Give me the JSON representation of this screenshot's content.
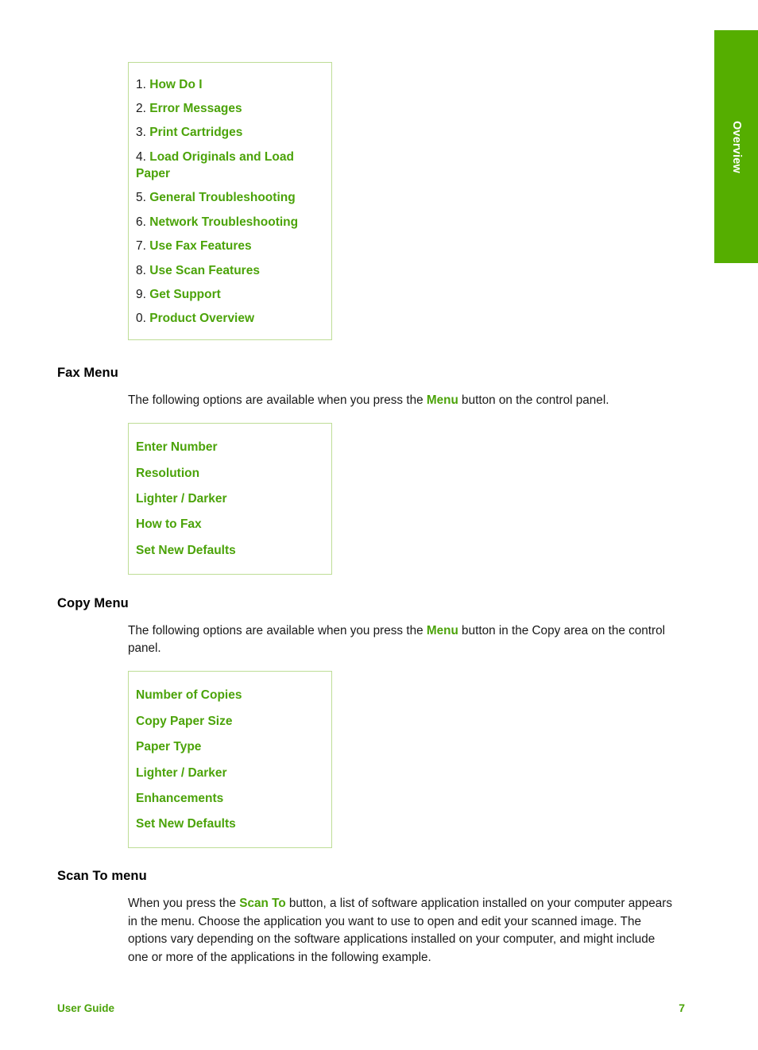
{
  "colors": {
    "accent_green": "#4ba309",
    "tab_green": "#55ae00",
    "box_border": "#bedd96",
    "body_text": "#1a1a1a"
  },
  "chapter_tab": {
    "label": "Overview"
  },
  "top_menu_box": {
    "items": [
      {
        "number": "1.",
        "label": "How Do I"
      },
      {
        "number": "2.",
        "label": "Error Messages"
      },
      {
        "number": "3.",
        "label": "Print Cartridges"
      },
      {
        "number": "4.",
        "label": "Load Originals and Load Paper"
      },
      {
        "number": "5.",
        "label": "General Troubleshooting"
      },
      {
        "number": "6.",
        "label": "Network Troubleshooting"
      },
      {
        "number": "7.",
        "label": "Use Fax Features"
      },
      {
        "number": "8.",
        "label": "Use Scan Features"
      },
      {
        "number": "9.",
        "label": "Get Support"
      },
      {
        "number": "0.",
        "label": "Product Overview"
      }
    ]
  },
  "sections": [
    {
      "title": "Fax Menu",
      "paragraph_before": "The following options are available when you press the ",
      "paragraph_highlight": "Menu",
      "paragraph_after": " button on the control panel.",
      "menu_items": [
        "Enter Number",
        "Resolution",
        "Lighter / Darker",
        "How to Fax",
        "Set New Defaults"
      ]
    },
    {
      "title": "Copy Menu",
      "paragraph_before": "The following options are available when you press the ",
      "paragraph_highlight": "Menu",
      "paragraph_after": " button in the Copy area on the control panel.",
      "menu_items": [
        "Number of Copies",
        "Copy Paper Size",
        "Paper Type",
        "Lighter / Darker",
        "Enhancements",
        "Set New Defaults"
      ]
    },
    {
      "title": "Scan To menu",
      "paragraph_before": "When you press the ",
      "paragraph_highlight": "Scan To",
      "paragraph_after": " button, a list of software application installed on your computer appears in the menu. Choose the application you want to use to open and edit your scanned image. The options vary depending on the software applications installed on your computer, and might include one or more of the applications in the following example."
    }
  ],
  "footer": {
    "left_label": "User Guide",
    "page_number": "7"
  }
}
